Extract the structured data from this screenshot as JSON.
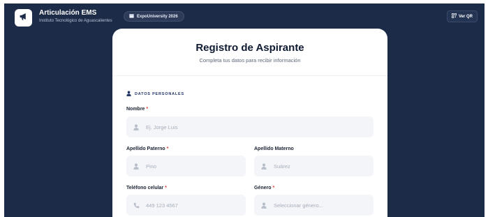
{
  "header": {
    "app_title": "Articulación EMS",
    "app_subtitle": "Instituto Tecnológico de Aguascalientes",
    "event_badge": "ExpoUniversity 2026",
    "qr_button": "Ver QR"
  },
  "form": {
    "title": "Registro de Aspirante",
    "subtitle": "Completa tus datos para recibir información",
    "section_title": "DATOS PERSONALES",
    "fields": {
      "nombre": {
        "label": "Nombre",
        "placeholder": "Ej. Jorge Luis",
        "required": "*"
      },
      "apellido_paterno": {
        "label": "Apellido Paterno",
        "placeholder": "Pino",
        "required": "*"
      },
      "apellido_materno": {
        "label": "Apellido Materno",
        "placeholder": "Suárez"
      },
      "telefono": {
        "label": "Teléfono celular",
        "placeholder": "449 123 4567",
        "required": "*"
      },
      "genero": {
        "label": "Género",
        "placeholder": "Seleccionar género...",
        "required": "*"
      }
    }
  },
  "colors": {
    "background": "#1c2b48",
    "card": "#ffffff",
    "accent": "#1f3366",
    "required": "#e03a3a"
  },
  "icons": {
    "logo": "megaphone-icon",
    "badge": "calendar-icon",
    "qr": "qr-code-icon",
    "section": "user-icon",
    "field_user": "user-icon",
    "field_phone": "phone-icon"
  }
}
